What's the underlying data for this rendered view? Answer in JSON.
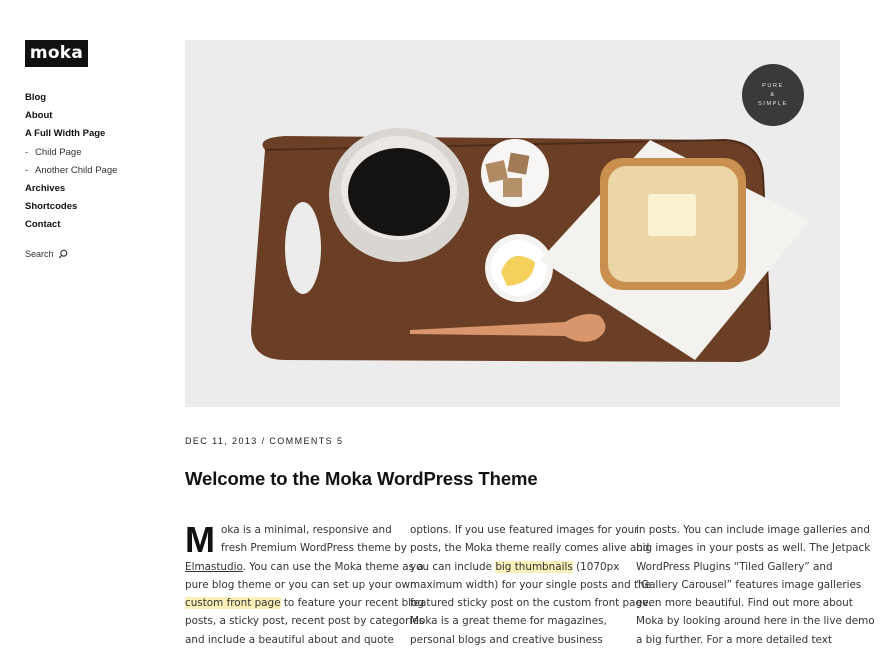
{
  "site": {
    "logo": "moka"
  },
  "nav": {
    "items": [
      {
        "label": "Blog",
        "child": false
      },
      {
        "label": "About",
        "child": false
      },
      {
        "label": "A Full Width Page",
        "child": false
      },
      {
        "label": "Child Page",
        "child": true
      },
      {
        "label": "Another Child Page",
        "child": true
      },
      {
        "label": "Archives",
        "child": false
      },
      {
        "label": "Shortcodes",
        "child": false
      },
      {
        "label": "Contact",
        "child": false
      }
    ],
    "child_marker": "-"
  },
  "search": {
    "label": "Search",
    "icon": "search-icon"
  },
  "hero": {
    "badge_lines": [
      "PURE",
      "&",
      "SIMPLE"
    ],
    "colors": {
      "background": "#ececec",
      "board": "#6b3f26",
      "badge": "#3a3a3a"
    }
  },
  "post": {
    "date": "DEC 11, 2013",
    "separator": " / ",
    "comments": "COMMENTS 5",
    "title": "Welcome to the Moka WordPress Theme",
    "dropcap": "M",
    "col1": {
      "l1": "oka is a minimal, responsive and",
      "l2": "fresh Premium WordPress theme by",
      "l3_link": "Elmastudio",
      "l3_rest": ". You can use the Moka theme as a",
      "l4": "pure blog theme or you can set up your own",
      "l5_hl": "custom front page",
      "l5_rest": " to feature your recent blog",
      "l6": "posts, a sticky post, recent post by categories",
      "l7": "and include a beautiful about and quote"
    },
    "col2": {
      "l1": "options. If you use featured images for your",
      "l2": "posts, the Moka theme really comes alive and",
      "l3_pre": "you can include ",
      "l3_hl": "big thumbnails",
      "l3_rest": " (1070px",
      "l4": "maximum width) for your single posts and the",
      "l5": "featured sticky post on the custom front page.",
      "l6": "Moka is a great theme for magazines,",
      "l7": "personal blogs and creative business"
    },
    "col3": {
      "l1": "in posts. You can include image galleries and",
      "l2": "big images in your posts as well. The Jetpack",
      "l3": "WordPress Plugins “Tiled Gallery” and",
      "l4": "“Gallery Carousel” features image galleries",
      "l5": "even more beautiful. Find out more about",
      "l6": "Moka by looking around here in the live demo",
      "l7": "a big further. For a more detailed text"
    }
  }
}
